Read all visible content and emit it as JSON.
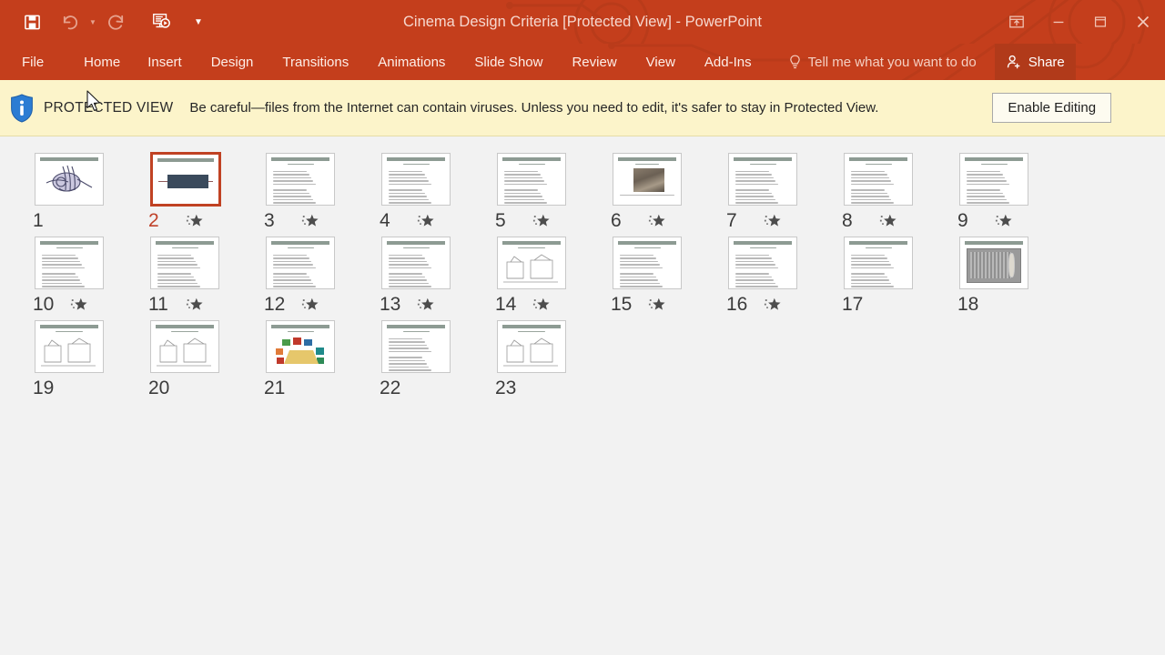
{
  "window": {
    "title": "Cinema Design Criteria [Protected View] - PowerPoint",
    "quick_access": [
      {
        "name": "save-button",
        "icon": "save-icon",
        "state": "enabled"
      },
      {
        "name": "undo-button",
        "icon": "undo-icon",
        "state": "disabled"
      },
      {
        "name": "redo-button",
        "icon": "redo-icon",
        "state": "disabled"
      },
      {
        "name": "start-slideshow-button",
        "icon": "slideshow-icon",
        "state": "enabled"
      },
      {
        "name": "customize-quick-access-toolbar",
        "icon": "chevron-down-icon",
        "state": "enabled"
      }
    ],
    "controls": [
      {
        "name": "ribbon-display-options",
        "icon": "ribbon-display-icon"
      },
      {
        "name": "minimize-button",
        "icon": "minimize-icon"
      },
      {
        "name": "restore-button",
        "icon": "restore-icon"
      },
      {
        "name": "close-button",
        "icon": "close-icon"
      }
    ]
  },
  "ribbon": {
    "tabs": [
      {
        "label": "File"
      },
      {
        "label": "Home"
      },
      {
        "label": "Insert"
      },
      {
        "label": "Design"
      },
      {
        "label": "Transitions"
      },
      {
        "label": "Animations"
      },
      {
        "label": "Slide Show"
      },
      {
        "label": "Review"
      },
      {
        "label": "View"
      },
      {
        "label": "Add-Ins"
      }
    ],
    "tell_me": "Tell me what you want to do",
    "share": "Share"
  },
  "protected_view": {
    "label": "PROTECTED VIEW",
    "message": "Be careful—files from the Internet can contain viruses. Unless you need to edit, it's safer to stay in Protected View.",
    "enable_button": "Enable Editing"
  },
  "colors": {
    "accent": "#c43e1c",
    "selection": "#c0422a",
    "banner_bg": "#fcf4ca",
    "canvas_bg": "#f2f2f2"
  },
  "slides": [
    {
      "number": "1",
      "selected": false,
      "animated": false,
      "kind": "logo"
    },
    {
      "number": "2",
      "selected": true,
      "animated": true,
      "kind": "title"
    },
    {
      "number": "3",
      "selected": false,
      "animated": true,
      "kind": "text"
    },
    {
      "number": "4",
      "selected": false,
      "animated": true,
      "kind": "text"
    },
    {
      "number": "5",
      "selected": false,
      "animated": true,
      "kind": "text"
    },
    {
      "number": "6",
      "selected": false,
      "animated": true,
      "kind": "photo"
    },
    {
      "number": "7",
      "selected": false,
      "animated": true,
      "kind": "text"
    },
    {
      "number": "8",
      "selected": false,
      "animated": true,
      "kind": "text"
    },
    {
      "number": "9",
      "selected": false,
      "animated": true,
      "kind": "text"
    },
    {
      "number": "10",
      "selected": false,
      "animated": true,
      "kind": "text"
    },
    {
      "number": "11",
      "selected": false,
      "animated": true,
      "kind": "text"
    },
    {
      "number": "12",
      "selected": false,
      "animated": true,
      "kind": "text"
    },
    {
      "number": "13",
      "selected": false,
      "animated": true,
      "kind": "text"
    },
    {
      "number": "14",
      "selected": false,
      "animated": true,
      "kind": "drawing"
    },
    {
      "number": "15",
      "selected": false,
      "animated": true,
      "kind": "text"
    },
    {
      "number": "16",
      "selected": false,
      "animated": true,
      "kind": "text"
    },
    {
      "number": "17",
      "selected": false,
      "animated": false,
      "kind": "text"
    },
    {
      "number": "18",
      "selected": false,
      "animated": false,
      "kind": "seating"
    },
    {
      "number": "19",
      "selected": false,
      "animated": false,
      "kind": "drawing"
    },
    {
      "number": "20",
      "selected": false,
      "animated": false,
      "kind": "drawing"
    },
    {
      "number": "21",
      "selected": false,
      "animated": false,
      "kind": "colordiagram"
    },
    {
      "number": "22",
      "selected": false,
      "animated": false,
      "kind": "text"
    },
    {
      "number": "23",
      "selected": false,
      "animated": false,
      "kind": "drawing"
    }
  ]
}
